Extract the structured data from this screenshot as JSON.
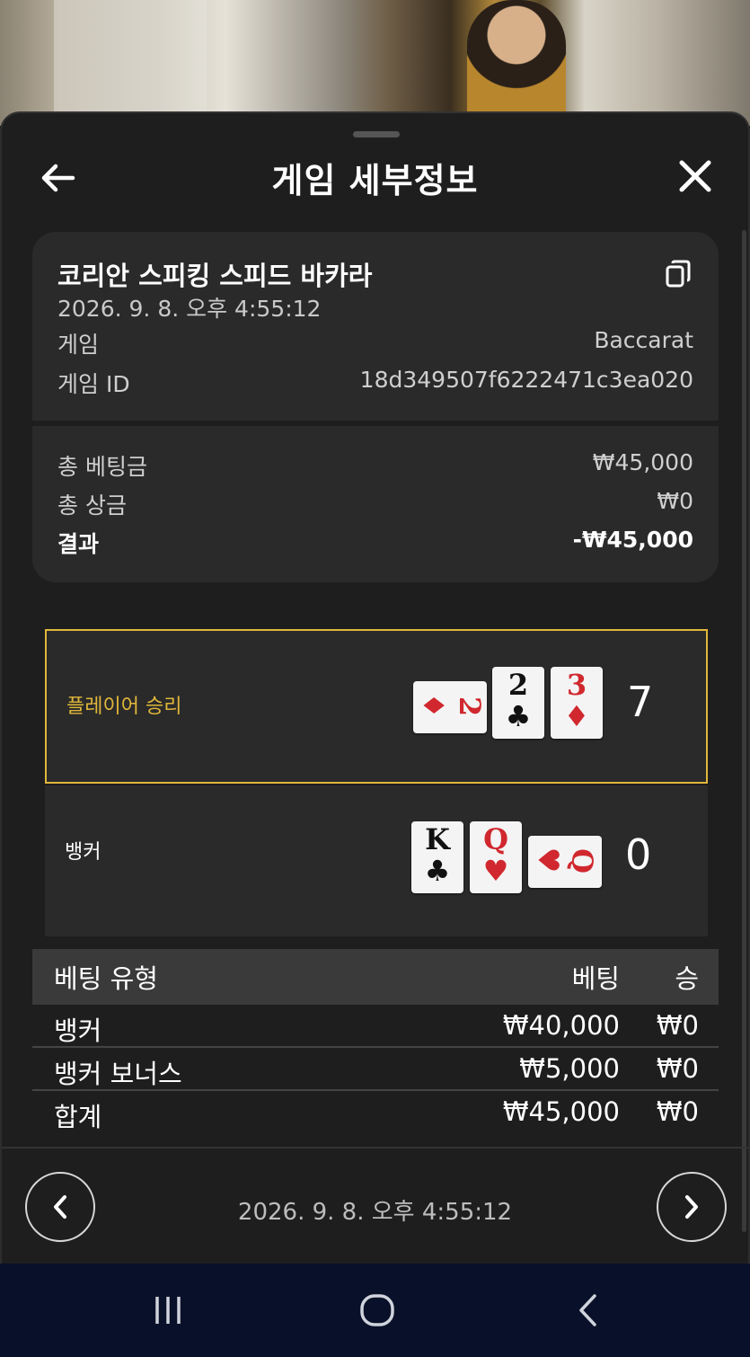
{
  "header": {
    "title": "게임 세부정보"
  },
  "game": {
    "name": "코리안 스피킹 스피드 바카라",
    "datetime": "2026. 9. 8. 오후 4:55:12",
    "rows": [
      {
        "label": "게임",
        "value": "Baccarat"
      },
      {
        "label": "게임 ID",
        "value": "18d349507f6222471c3ea020"
      }
    ]
  },
  "summary": {
    "rows": [
      {
        "label": "총 베팅금",
        "value": "₩45,000"
      },
      {
        "label": "총 상금",
        "value": "₩0"
      },
      {
        "label": "결과",
        "value": "-₩45,000"
      }
    ]
  },
  "player": {
    "label": "플레이어 승리",
    "score": "7",
    "cards": [
      {
        "rank": "2",
        "suit": "♦",
        "color": "red",
        "orientation": "sideways"
      },
      {
        "rank": "2",
        "suit": "♣",
        "color": "black",
        "orientation": "upright"
      },
      {
        "rank": "3",
        "suit": "♦",
        "color": "red",
        "orientation": "upright"
      }
    ]
  },
  "banker": {
    "label": "뱅커",
    "score": "0",
    "cards": [
      {
        "rank": "K",
        "suit": "♣",
        "color": "black",
        "orientation": "upright"
      },
      {
        "rank": "Q",
        "suit": "♥",
        "color": "red",
        "orientation": "upright"
      },
      {
        "rank": "Q",
        "suit": "♥",
        "color": "red",
        "orientation": "sideways"
      }
    ]
  },
  "bets": {
    "headers": {
      "type": "베팅 유형",
      "bet": "베팅",
      "win": "승"
    },
    "rows": [
      {
        "type": "뱅커",
        "bet": "₩40,000",
        "win": "₩0"
      },
      {
        "type": "뱅커 보너스",
        "bet": "₩5,000",
        "win": "₩0"
      },
      {
        "type": "합계",
        "bet": "₩45,000",
        "win": "₩0"
      }
    ]
  },
  "footer": {
    "datetime": "2026. 9. 8. 오후 4:55:12"
  },
  "colors": {
    "accent": "#e0b73a",
    "red_suit": "#d0282e",
    "sheet_bg": "#1e1e1e",
    "card_bg": "#2a2a2a",
    "nav_bar": "#081129"
  },
  "icons": [
    "arrow-left-icon",
    "close-icon",
    "copy-icon",
    "chevron-left-icon",
    "chevron-right-icon",
    "recent-apps-icon",
    "home-icon",
    "system-back-icon"
  ]
}
